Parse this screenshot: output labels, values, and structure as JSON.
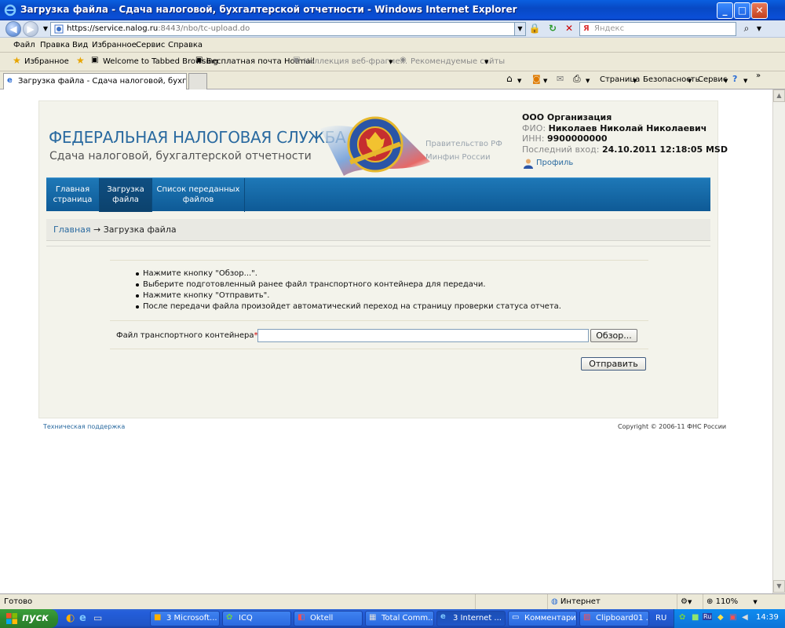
{
  "window": {
    "title": "Загрузка файла - Сдача налоговой, бухгалтерской отчетности - Windows Internet Explorer",
    "minimize": "_",
    "maximize": "□",
    "close": "✕"
  },
  "nav": {
    "back": "◀",
    "forward": "▶",
    "url_host": "https://service.nalog.ru",
    "url_rest": ":8443/nbo/tc-upload.do",
    "search_placeholder": "Яндекс"
  },
  "menu": [
    "Файл",
    "Правка",
    "Вид",
    "Избранное",
    "Сервис",
    "Справка"
  ],
  "favorites": {
    "label": "Избранное",
    "items": [
      "Welcome to Tabbed Browsing",
      "Бесплатная почта Hotmail",
      "Коллекция веб-фрагме...",
      "Рекомендуемые сайты"
    ]
  },
  "tab": {
    "label": "Загрузка файла - Сдача налоговой, бухгалтерско..."
  },
  "commandbar": [
    "Страница",
    "Безопасность",
    "Сервис"
  ],
  "site": {
    "title": "ФЕДЕРАЛЬНАЯ НАЛОГОВАЯ СЛУЖБА",
    "subtitle": "Сдача налоговой, бухгалтерской отчетности",
    "emblem_text": "ФЕДЕРАЛЬНАЯ НАЛОГОВАЯ СЛУЖБА",
    "gov_link": "Правительство РФ",
    "minfin_link": "Минфин России",
    "org": "ООО Организация",
    "fio_label": "ФИО:",
    "fio": "Николаев Николай Николаевич",
    "inn_label": "ИНН:",
    "inn": "9900000000",
    "last_login_label": "Последний вход:",
    "last_login": "24.10.2011 12:18:05 MSD",
    "profile": "Профиль"
  },
  "sitenav": [
    {
      "line1": "Главная",
      "line2": "страница"
    },
    {
      "line1": "Загрузка",
      "line2": "файла"
    },
    {
      "line1": "Список переданных",
      "line2": "файлов"
    }
  ],
  "breadcrumb": {
    "home": "Главная",
    "current": " → Загрузка файла"
  },
  "instructions": [
    "Нажмите кнопку \"Обзор...\".",
    "Выберите подготовленный ранее файл транспортного контейнера для передачи.",
    "Нажмите кнопку \"Отправить\".",
    "После передачи файла произойдет автоматический переход на страницу проверки статуса отчета."
  ],
  "form": {
    "file_label": "Файл транспортного контейнера",
    "required_mark": "*",
    "colon": ":",
    "browse": "Обзор...",
    "submit": "Отправить"
  },
  "footer": {
    "support": "Техническая поддержка",
    "copyright": "Copyright © 2006-11 ФНС России"
  },
  "status": {
    "ready": "Готово",
    "zone": "Интернет",
    "zoom": "110%"
  },
  "taskbar": {
    "start": "пуск",
    "items": [
      "3 Microsoft...",
      "ICQ",
      "Oktell",
      "Total Comm...",
      "3 Internet ...",
      "Комментари...",
      "Clipboard01 ..."
    ],
    "lang": "RU",
    "clock": "14:39"
  }
}
